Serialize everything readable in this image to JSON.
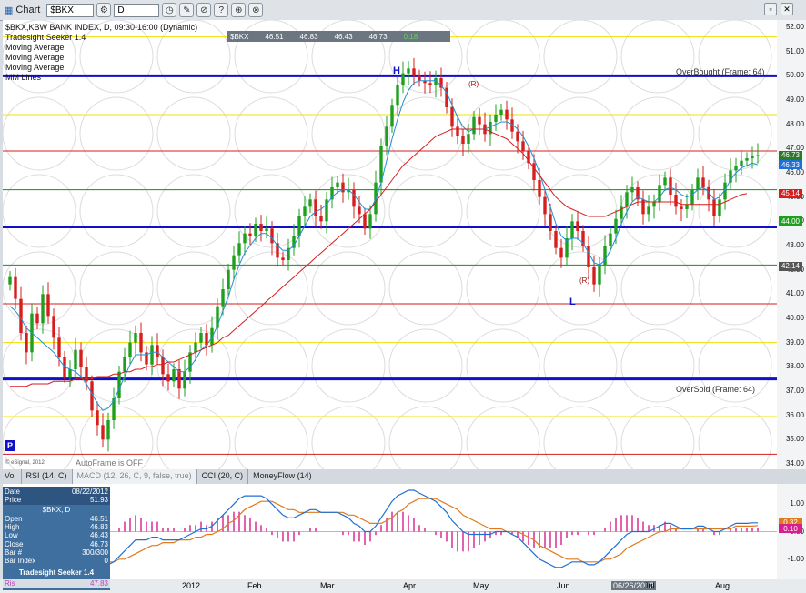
{
  "toolbar": {
    "title": "Chart",
    "symbol": "$BKX",
    "interval": "D"
  },
  "legend": [
    "$BKX,KBW BANK INDEX, D, 09:30-16:00 (Dynamic)",
    "Tradesight Seeker 1.4",
    "Moving Average",
    "Moving Average",
    "Moving Average",
    "MM Lines"
  ],
  "ohlc_strip": {
    "sym": "$BKX",
    "open": "46.51",
    "high": "46.83",
    "low": "46.43",
    "close": "46.73",
    "chg": "0.18"
  },
  "annotations": {
    "overbought": "OverBought (Frame: 64)",
    "oversold": "OverSold (Frame: 64)",
    "autoframe": "AutoFrame is OFF",
    "esignal": "© eSignal, 2012",
    "high_mark": "H",
    "low_mark": "L",
    "r1": "(R)",
    "r2": "(R)",
    "p_mark": "P"
  },
  "price_axis": [
    "52.00",
    "51.00",
    "50.00",
    "49.00",
    "48.00",
    "47.00",
    "46.00",
    "45.00",
    "44.00",
    "43.00",
    "42.00",
    "41.00",
    "40.00",
    "39.00",
    "38.00",
    "37.00",
    "36.00",
    "35.00",
    "34.00"
  ],
  "price_badges": [
    {
      "text": "46.73",
      "color": "#2a7a2a"
    },
    {
      "text": "46.33",
      "color": "#1e6fd6"
    },
    {
      "text": "45.14",
      "color": "#d61e1e"
    },
    {
      "text": "44.00",
      "color": "#1ea01e"
    },
    {
      "text": "42.14",
      "color": "#555555"
    }
  ],
  "tabs": [
    "Vol",
    "RSI (14, C)",
    "MACD (12, 26, C, 9, false, true)",
    "CCI (20, C)",
    "MoneyFlow (14)"
  ],
  "osc_axis": [
    "1.00",
    "0.00",
    "-1.00"
  ],
  "osc_badges": [
    {
      "text": "0.32",
      "color": "#e07a20"
    },
    {
      "text": "0.10",
      "color": "#d61e8c"
    }
  ],
  "x_axis": [
    "2012",
    "Feb",
    "Mar",
    "Apr",
    "May",
    "Jun",
    "06/26/2012",
    "Jul",
    "Aug"
  ],
  "databox": {
    "rows_top": [
      [
        "Date",
        "08/22/2012"
      ],
      [
        "Price",
        "51.93"
      ]
    ],
    "symbol": "$BKX, D",
    "rows": [
      [
        "Open",
        "46.51"
      ],
      [
        "High",
        "46.83"
      ],
      [
        "Low",
        "46.43"
      ],
      [
        "Close",
        "46.73"
      ],
      [
        "Bar #",
        "300/300"
      ],
      [
        "Bar Index",
        "0"
      ]
    ],
    "study": "Tradesight Seeker 1.4",
    "ris": [
      "Ris",
      "47.83"
    ]
  },
  "colors": {
    "up": "#1ea01e",
    "down": "#d61e1e",
    "background": "#ffffff",
    "overbought": "#1010c8",
    "macd": "#1e6fd6",
    "signal": "#e07a20",
    "histogram": "#d61e8c"
  },
  "chart_data": {
    "type": "candlestick",
    "title": "$BKX,KBW BANK INDEX, D",
    "ylim": [
      34,
      52
    ],
    "x_ticks": [
      "2012",
      "Feb",
      "Mar",
      "Apr",
      "May",
      "Jun",
      "Jul",
      "Aug"
    ],
    "hlines": [
      {
        "y": 51.6,
        "color": "#f0e000",
        "width": 1
      },
      {
        "y": 50.0,
        "color": "#1010c8",
        "width": 3
      },
      {
        "y": 48.4,
        "color": "#f0e000",
        "width": 1
      },
      {
        "y": 46.9,
        "color": "#d61e1e",
        "width": 1
      },
      {
        "y": 45.3,
        "color": "#1e8a1e",
        "width": 1
      },
      {
        "y": 43.75,
        "color": "#1010c8",
        "width": 2
      },
      {
        "y": 42.2,
        "color": "#1e8a1e",
        "width": 1
      },
      {
        "y": 40.6,
        "color": "#d61e1e",
        "width": 1
      },
      {
        "y": 39.0,
        "color": "#f0e000",
        "width": 1
      },
      {
        "y": 37.5,
        "color": "#1010c8",
        "width": 3
      },
      {
        "y": 35.95,
        "color": "#f0e000",
        "width": 1
      },
      {
        "y": 34.4,
        "color": "#d61e1e",
        "width": 1
      }
    ],
    "close": [
      41.7,
      40.8,
      39.4,
      38.6,
      40.2,
      39.8,
      41.0,
      40.1,
      39.2,
      38.4,
      37.6,
      37.9,
      38.7,
      38.0,
      37.4,
      36.2,
      35.6,
      35.0,
      35.8,
      36.7,
      37.8,
      38.4,
      39.0,
      39.4,
      38.6,
      38.1,
      38.9,
      38.4,
      37.7,
      37.4,
      37.9,
      37.1,
      37.8,
      38.6,
      39.0,
      39.4,
      38.9,
      39.6,
      40.5,
      41.2,
      42.0,
      42.6,
      43.1,
      43.5,
      43.4,
      43.9,
      43.6,
      43.7,
      43.1,
      42.5,
      42.4,
      42.9,
      43.4,
      44.2,
      44.6,
      44.9,
      44.2,
      44.0,
      44.9,
      45.4,
      45.6,
      45.2,
      45.3,
      44.6,
      44.3,
      43.7,
      44.3,
      45.6,
      47.1,
      47.9,
      48.8,
      49.6,
      50.1,
      50.3,
      50.0,
      49.8,
      49.7,
      49.6,
      49.9,
      49.5,
      48.7,
      47.9,
      47.5,
      47.2,
      47.6,
      48.3,
      48.0,
      47.6,
      48.1,
      48.4,
      48.6,
      48.2,
      47.7,
      47.3,
      46.9,
      46.4,
      45.7,
      45.0,
      44.3,
      43.6,
      42.9,
      42.5,
      43.3,
      44.0,
      43.6,
      43.0,
      42.1,
      41.4,
      42.2,
      43.0,
      43.5,
      44.1,
      44.6,
      45.2,
      45.4,
      44.9,
      44.3,
      44.6,
      44.8,
      45.5,
      45.8,
      45.1,
      44.6,
      44.5,
      44.7,
      45.3,
      45.8,
      45.4,
      44.9,
      44.2,
      44.9,
      45.6,
      46.1,
      46.3,
      46.5,
      46.6,
      46.7,
      46.73
    ],
    "ma_fast": [
      40.5,
      40.3,
      40.0,
      39.6,
      39.4,
      39.2,
      39.0,
      38.8,
      38.6,
      38.3,
      38.0,
      37.9,
      37.8,
      37.6,
      37.3,
      36.9,
      36.5,
      36.2,
      36.3,
      36.6,
      37.1,
      37.6,
      38.1,
      38.5,
      38.5,
      38.5,
      38.6,
      38.6,
      38.4,
      38.2,
      38.0,
      37.8,
      37.8,
      38.0,
      38.3,
      38.7,
      38.9,
      39.2,
      39.7,
      40.3,
      40.9,
      41.6,
      42.2,
      42.7,
      43.0,
      43.3,
      43.5,
      43.5,
      43.3,
      43.0,
      42.8,
      42.8,
      43.0,
      43.4,
      43.8,
      44.2,
      44.4,
      44.5,
      44.7,
      45.0,
      45.2,
      45.3,
      45.3,
      45.1,
      44.8,
      44.5,
      44.5,
      44.9,
      45.6,
      46.5,
      47.4,
      48.2,
      48.9,
      49.4,
      49.7,
      49.8,
      49.8,
      49.8,
      49.8,
      49.6,
      49.3,
      48.8,
      48.3,
      47.9,
      47.7,
      47.8,
      47.8,
      47.8,
      47.9,
      48.0,
      48.1,
      48.1,
      48.0,
      47.8,
      47.5,
      47.1,
      46.6,
      46.0,
      45.3,
      44.6,
      43.9,
      43.4,
      43.2,
      43.3,
      43.3,
      43.1,
      42.7,
      42.3,
      42.2,
      42.4,
      42.8,
      43.3,
      43.9,
      44.4,
      44.8,
      45.0,
      44.9,
      44.8,
      44.8,
      45.0,
      45.3,
      45.4,
      45.3,
      45.1,
      45.0,
      45.1,
      45.3,
      45.4,
      45.2,
      44.9,
      45.0,
      45.3,
      45.7,
      46.0,
      46.2,
      46.3,
      46.4,
      46.33
    ],
    "ma_slow": [
      37.2,
      37.2,
      37.2,
      37.2,
      37.3,
      37.3,
      37.3,
      37.3,
      37.4,
      37.4,
      37.4,
      37.4,
      37.5,
      37.5,
      37.5,
      37.5,
      37.6,
      37.6,
      37.6,
      37.7,
      37.7,
      37.8,
      37.8,
      37.9,
      37.9,
      38.0,
      38.0,
      38.1,
      38.1,
      38.2,
      38.2,
      38.3,
      38.4,
      38.5,
      38.6,
      38.7,
      38.8,
      38.9,
      39.0,
      39.2,
      39.3,
      39.5,
      39.7,
      39.9,
      40.1,
      40.3,
      40.5,
      40.7,
      40.9,
      41.1,
      41.3,
      41.5,
      41.7,
      41.9,
      42.1,
      42.3,
      42.5,
      42.7,
      42.9,
      43.1,
      43.3,
      43.5,
      43.7,
      43.9,
      44.1,
      44.3,
      44.5,
      44.8,
      45.1,
      45.4,
      45.7,
      46.0,
      46.3,
      46.5,
      46.7,
      46.9,
      47.1,
      47.3,
      47.5,
      47.6,
      47.7,
      47.8,
      47.8,
      47.8,
      47.8,
      47.8,
      47.8,
      47.8,
      47.7,
      47.6,
      47.5,
      47.4,
      47.2,
      47.0,
      46.8,
      46.5,
      46.2,
      45.9,
      45.6,
      45.3,
      45.0,
      44.8,
      44.6,
      44.5,
      44.4,
      44.3,
      44.2,
      44.2,
      44.2,
      44.2,
      44.3,
      44.4,
      44.5,
      44.6,
      44.7,
      44.8,
      44.8,
      44.8,
      44.8,
      44.8,
      44.8,
      44.8,
      44.8,
      44.7,
      44.7,
      44.7,
      44.7,
      44.7,
      44.7,
      44.7,
      44.7,
      44.8,
      44.9,
      45.0,
      45.1,
      45.14
    ],
    "macd": [
      0.1,
      0.0,
      -0.2,
      -0.4,
      -0.5,
      -0.6,
      -0.6,
      -0.7,
      -0.8,
      -0.9,
      -1.0,
      -1.0,
      -1.0,
      -1.0,
      -1.1,
      -1.2,
      -1.3,
      -1.3,
      -1.2,
      -1.1,
      -0.9,
      -0.7,
      -0.5,
      -0.3,
      -0.3,
      -0.3,
      -0.2,
      -0.2,
      -0.3,
      -0.3,
      -0.3,
      -0.3,
      -0.2,
      -0.1,
      0.0,
      0.1,
      0.1,
      0.2,
      0.4,
      0.6,
      0.8,
      1.0,
      1.2,
      1.3,
      1.3,
      1.3,
      1.3,
      1.2,
      1.0,
      0.8,
      0.6,
      0.5,
      0.5,
      0.6,
      0.7,
      0.8,
      0.8,
      0.7,
      0.7,
      0.7,
      0.7,
      0.6,
      0.5,
      0.3,
      0.2,
      0.0,
      0.0,
      0.2,
      0.5,
      0.8,
      1.1,
      1.3,
      1.4,
      1.5,
      1.5,
      1.4,
      1.3,
      1.2,
      1.1,
      0.9,
      0.7,
      0.4,
      0.2,
      0.0,
      -0.1,
      -0.1,
      -0.1,
      -0.1,
      -0.1,
      0.0,
      0.0,
      0.0,
      -0.1,
      -0.2,
      -0.4,
      -0.6,
      -0.8,
      -1.0,
      -1.1,
      -1.2,
      -1.3,
      -1.3,
      -1.2,
      -1.1,
      -1.1,
      -1.1,
      -1.2,
      -1.2,
      -1.1,
      -0.9,
      -0.7,
      -0.5,
      -0.3,
      -0.1,
      0.0,
      0.0,
      0.0,
      0.0,
      0.1,
      0.2,
      0.3,
      0.3,
      0.2,
      0.1,
      0.1,
      0.1,
      0.2,
      0.2,
      0.1,
      0.0,
      0.0,
      0.1,
      0.2,
      0.3,
      0.3,
      0.3,
      0.32,
      0.32
    ],
    "signal": [
      0.3,
      0.2,
      0.1,
      0.0,
      -0.1,
      -0.2,
      -0.3,
      -0.4,
      -0.5,
      -0.6,
      -0.7,
      -0.8,
      -0.8,
      -0.9,
      -0.9,
      -1.0,
      -1.0,
      -1.1,
      -1.1,
      -1.1,
      -1.0,
      -1.0,
      -0.9,
      -0.8,
      -0.7,
      -0.6,
      -0.5,
      -0.5,
      -0.4,
      -0.4,
      -0.4,
      -0.3,
      -0.3,
      -0.3,
      -0.2,
      -0.2,
      -0.1,
      -0.1,
      0.0,
      0.1,
      0.3,
      0.4,
      0.6,
      0.8,
      0.9,
      1.0,
      1.1,
      1.1,
      1.1,
      1.0,
      0.9,
      0.8,
      0.8,
      0.7,
      0.7,
      0.7,
      0.7,
      0.7,
      0.7,
      0.7,
      0.7,
      0.7,
      0.6,
      0.6,
      0.5,
      0.4,
      0.3,
      0.3,
      0.3,
      0.4,
      0.5,
      0.7,
      0.8,
      1.0,
      1.1,
      1.2,
      1.2,
      1.2,
      1.2,
      1.1,
      1.0,
      0.9,
      0.8,
      0.6,
      0.5,
      0.4,
      0.3,
      0.2,
      0.1,
      0.1,
      0.1,
      0.0,
      0.0,
      0.0,
      -0.1,
      -0.2,
      -0.3,
      -0.5,
      -0.6,
      -0.7,
      -0.8,
      -0.9,
      -1.0,
      -1.0,
      -1.0,
      -1.1,
      -1.1,
      -1.1,
      -1.1,
      -1.0,
      -1.0,
      -0.9,
      -0.8,
      -0.6,
      -0.5,
      -0.4,
      -0.3,
      -0.2,
      -0.1,
      0.0,
      0.0,
      0.1,
      0.1,
      0.1,
      0.1,
      0.1,
      0.1,
      0.1,
      0.1,
      0.1,
      0.1,
      0.1,
      0.1,
      0.2,
      0.2,
      0.2,
      0.2,
      0.22
    ]
  }
}
